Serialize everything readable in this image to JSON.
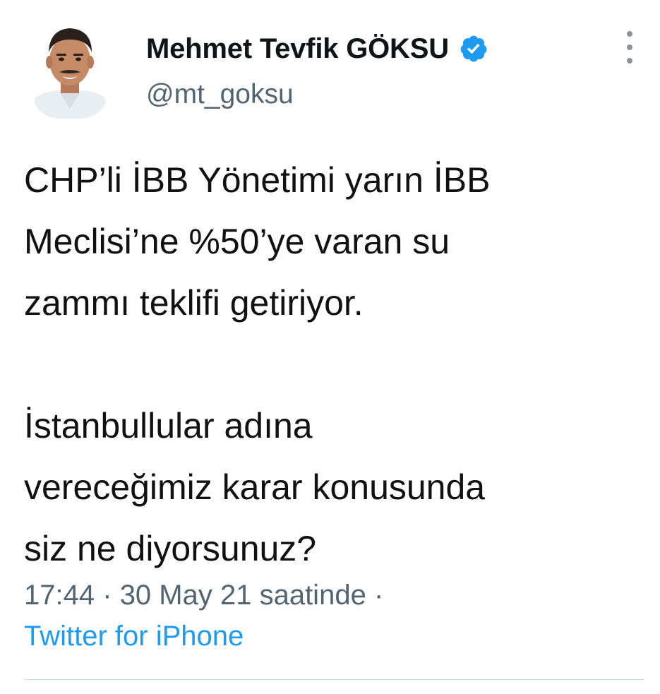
{
  "colors": {
    "text": "#0f1419",
    "secondary": "#536471",
    "link": "#1d9bf0",
    "verified": "#1d9bf0",
    "divider": "#cfd9de"
  },
  "author": {
    "display_name": "Mehmet Tevfik GÖKSU",
    "handle": "@mt_goksu",
    "verified_icon": "verified-badge-icon",
    "avatar": "profile-photo"
  },
  "tweet": {
    "lines": [
      "CHP’li İBB Yönetimi yarın İBB",
      "Meclisi’ne %50’ye varan su",
      "zammı teklifi getiriyor.",
      "",
      "İstanbullular adına",
      "vereceğimiz karar konusunda",
      "siz ne diyorsunuz?"
    ]
  },
  "meta": {
    "time": "17:44",
    "separator": "·",
    "date": "30 May 21 saatinde",
    "source": "Twitter for iPhone"
  },
  "menu": {
    "icon": "more-vertical-icon"
  }
}
